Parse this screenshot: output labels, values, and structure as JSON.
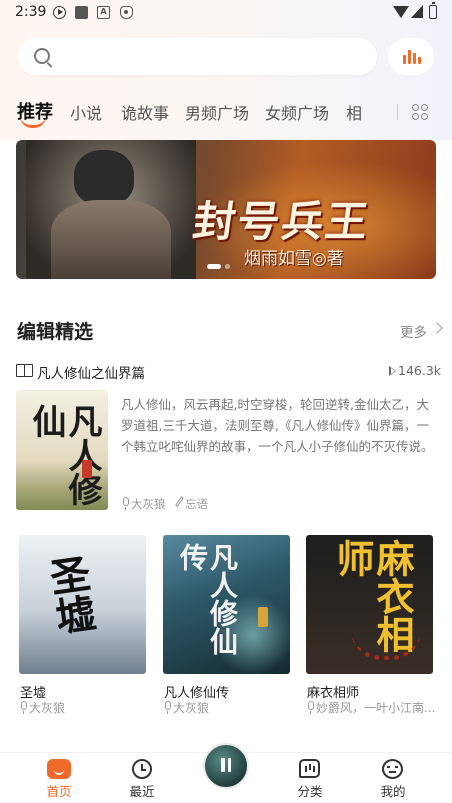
{
  "status_bar": {
    "time": "2:39"
  },
  "tabs": [
    "推荐",
    "小说",
    "诡故事",
    "男频广场",
    "女频广场",
    "相"
  ],
  "banner": {
    "title": "封号兵王",
    "author": "烟雨如雪◎著"
  },
  "section": {
    "title": "编辑精选",
    "more": "更多"
  },
  "featured": {
    "name": "凡人修仙之仙界篇",
    "play_count": "146.3k",
    "cover_text": "凡人修仙",
    "description": "凡人修仙，风云再起,时空穿梭，轮回逆转,金仙太乙，大罗道祖,三千大道，法则至尊,《凡人修仙传》仙界篇，一个韩立叱咤仙界的故事，一个凡人小子修仙的不灭传说。",
    "narrator": "大灰狼",
    "writer": "忘语"
  },
  "books": [
    {
      "title": "圣墟",
      "narrator": "大灰狼",
      "cover_text": "圣墟"
    },
    {
      "title": "凡人修仙传",
      "narrator": "大灰狼",
      "cover_text": "凡人修仙传"
    },
    {
      "title": "麻衣相师",
      "narrator": "妙爵风，一叶小江南...",
      "cover_text": "麻衣相师"
    }
  ],
  "bottom_nav": [
    {
      "label": "首页",
      "icon": "home-icon",
      "active": true
    },
    {
      "label": "最近",
      "icon": "clock-icon"
    },
    {
      "label": "分类",
      "icon": "category-icon"
    },
    {
      "label": "我的",
      "icon": "profile-icon"
    }
  ],
  "colors": {
    "accent": "#f06a2c"
  }
}
